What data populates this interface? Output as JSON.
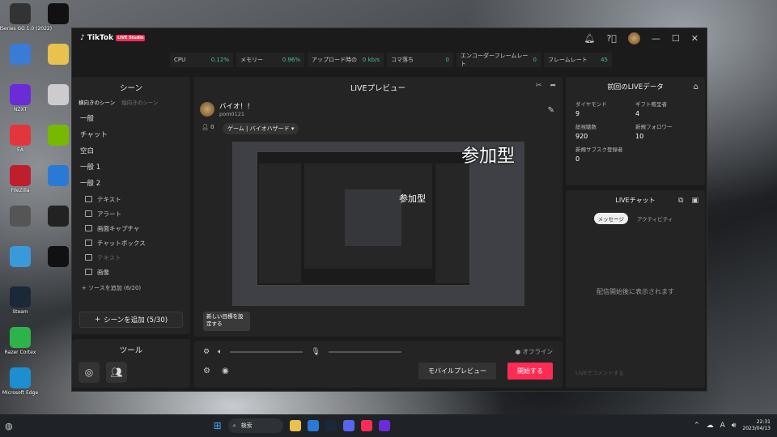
{
  "desktop": {
    "icons": [
      {
        "label": "SteelSeries GG 1.0 (2022)",
        "name": "steelseries-icon",
        "color": "#333"
      },
      {
        "label": "",
        "name": "capcut-icon",
        "color": "#111"
      },
      {
        "label": "",
        "name": "file-icon",
        "color": "#3a7bd5"
      },
      {
        "label": "",
        "name": "folder-icon",
        "color": "#e8c14e"
      },
      {
        "label": "NZXT",
        "name": "nzxt-icon",
        "color": "#6a2bd8"
      },
      {
        "label": "",
        "name": "doc-icon",
        "color": "#ccc"
      },
      {
        "label": "EA",
        "name": "ea-icon",
        "color": "#e2363c"
      },
      {
        "label": "",
        "name": "nvidia-icon",
        "color": "#76b900"
      },
      {
        "label": "FileZilla",
        "name": "filezilla-icon",
        "color": "#bf1e2d"
      },
      {
        "label": "",
        "name": "globe-icon",
        "color": "#2a7ad5"
      },
      {
        "label": "",
        "name": "lock-icon",
        "color": "#555"
      },
      {
        "label": "",
        "name": "sase-icon",
        "color": "#222"
      },
      {
        "label": "",
        "name": "recycle-icon",
        "color": "#3a9ad9"
      },
      {
        "label": "",
        "name": "logitech-icon",
        "color": "#111"
      },
      {
        "label": "Steam",
        "name": "steam-icon",
        "color": "#1b2838"
      },
      {
        "label": "Razer Cortex",
        "name": "razer-cortex-icon",
        "color": "#2db34a"
      },
      {
        "label": "Microsoft Edge",
        "name": "edge-icon",
        "color": "#1b8fd0"
      }
    ]
  },
  "app": {
    "brand": "TikTok",
    "badge": "LIVE Studio",
    "stats": [
      {
        "label": "CPU",
        "value": "0.12%"
      },
      {
        "label": "メモリー",
        "value": "0.96%"
      },
      {
        "label": "アップロード時の",
        "value": "0 kb/s"
      },
      {
        "label": "コマ落ち",
        "value": "0"
      },
      {
        "label": "エンコーダーフレームレート",
        "value": "0"
      },
      {
        "label": "フレームレート",
        "value": "45"
      }
    ]
  },
  "scenes": {
    "title": "シーン",
    "tab_active": "横向きのシーン",
    "tab_inactive": "縦向きのシーン",
    "items": [
      "一般",
      "チャット",
      "空白",
      "一般 1",
      "一般 2"
    ],
    "sources": [
      {
        "label": "テキスト",
        "dim": false
      },
      {
        "label": "アラート",
        "dim": false
      },
      {
        "label": "画面キャプチャ",
        "dim": false
      },
      {
        "label": "チャットボックス",
        "dim": false
      },
      {
        "label": "テキスト",
        "dim": true
      },
      {
        "label": "画像",
        "dim": false
      }
    ],
    "add_source": "ソースを追加 (6/20)",
    "add_scene": "シーンを追加 (5/30)"
  },
  "tools": {
    "title": "ツール"
  },
  "preview": {
    "title": "LIVEプレビュー",
    "username": "バイオ！！",
    "userid": "pom0121",
    "viewers": "0",
    "game": "ゲーム | バイオハザード",
    "overlay_text": "参加型",
    "overlay_text_small": "参加型",
    "goal": "新しい目標を設定する"
  },
  "controls": {
    "status": "オフライン",
    "mobile_preview": "モバイルプレビュー",
    "start": "開始する"
  },
  "last_live": {
    "title": "前回のLIVEデータ",
    "stats": [
      {
        "label": "ダイヤモンド",
        "value": "9"
      },
      {
        "label": "ギフト贈呈者",
        "value": "4"
      },
      {
        "label": "総視聴数",
        "value": "920"
      },
      {
        "label": "新規フォロワー",
        "value": "10"
      },
      {
        "label": "新規サブスク登録者",
        "value": "0"
      }
    ]
  },
  "chat": {
    "title": "LIVEチャット",
    "tab_messages": "メッセージ",
    "tab_activity": "アクティビティ",
    "empty": "配信開始後に表示されます",
    "input_placeholder": "LIVEでコメントする"
  },
  "taskbar": {
    "search": "検索",
    "time": "22:31",
    "date": "2023/04/13",
    "ime": "A"
  }
}
